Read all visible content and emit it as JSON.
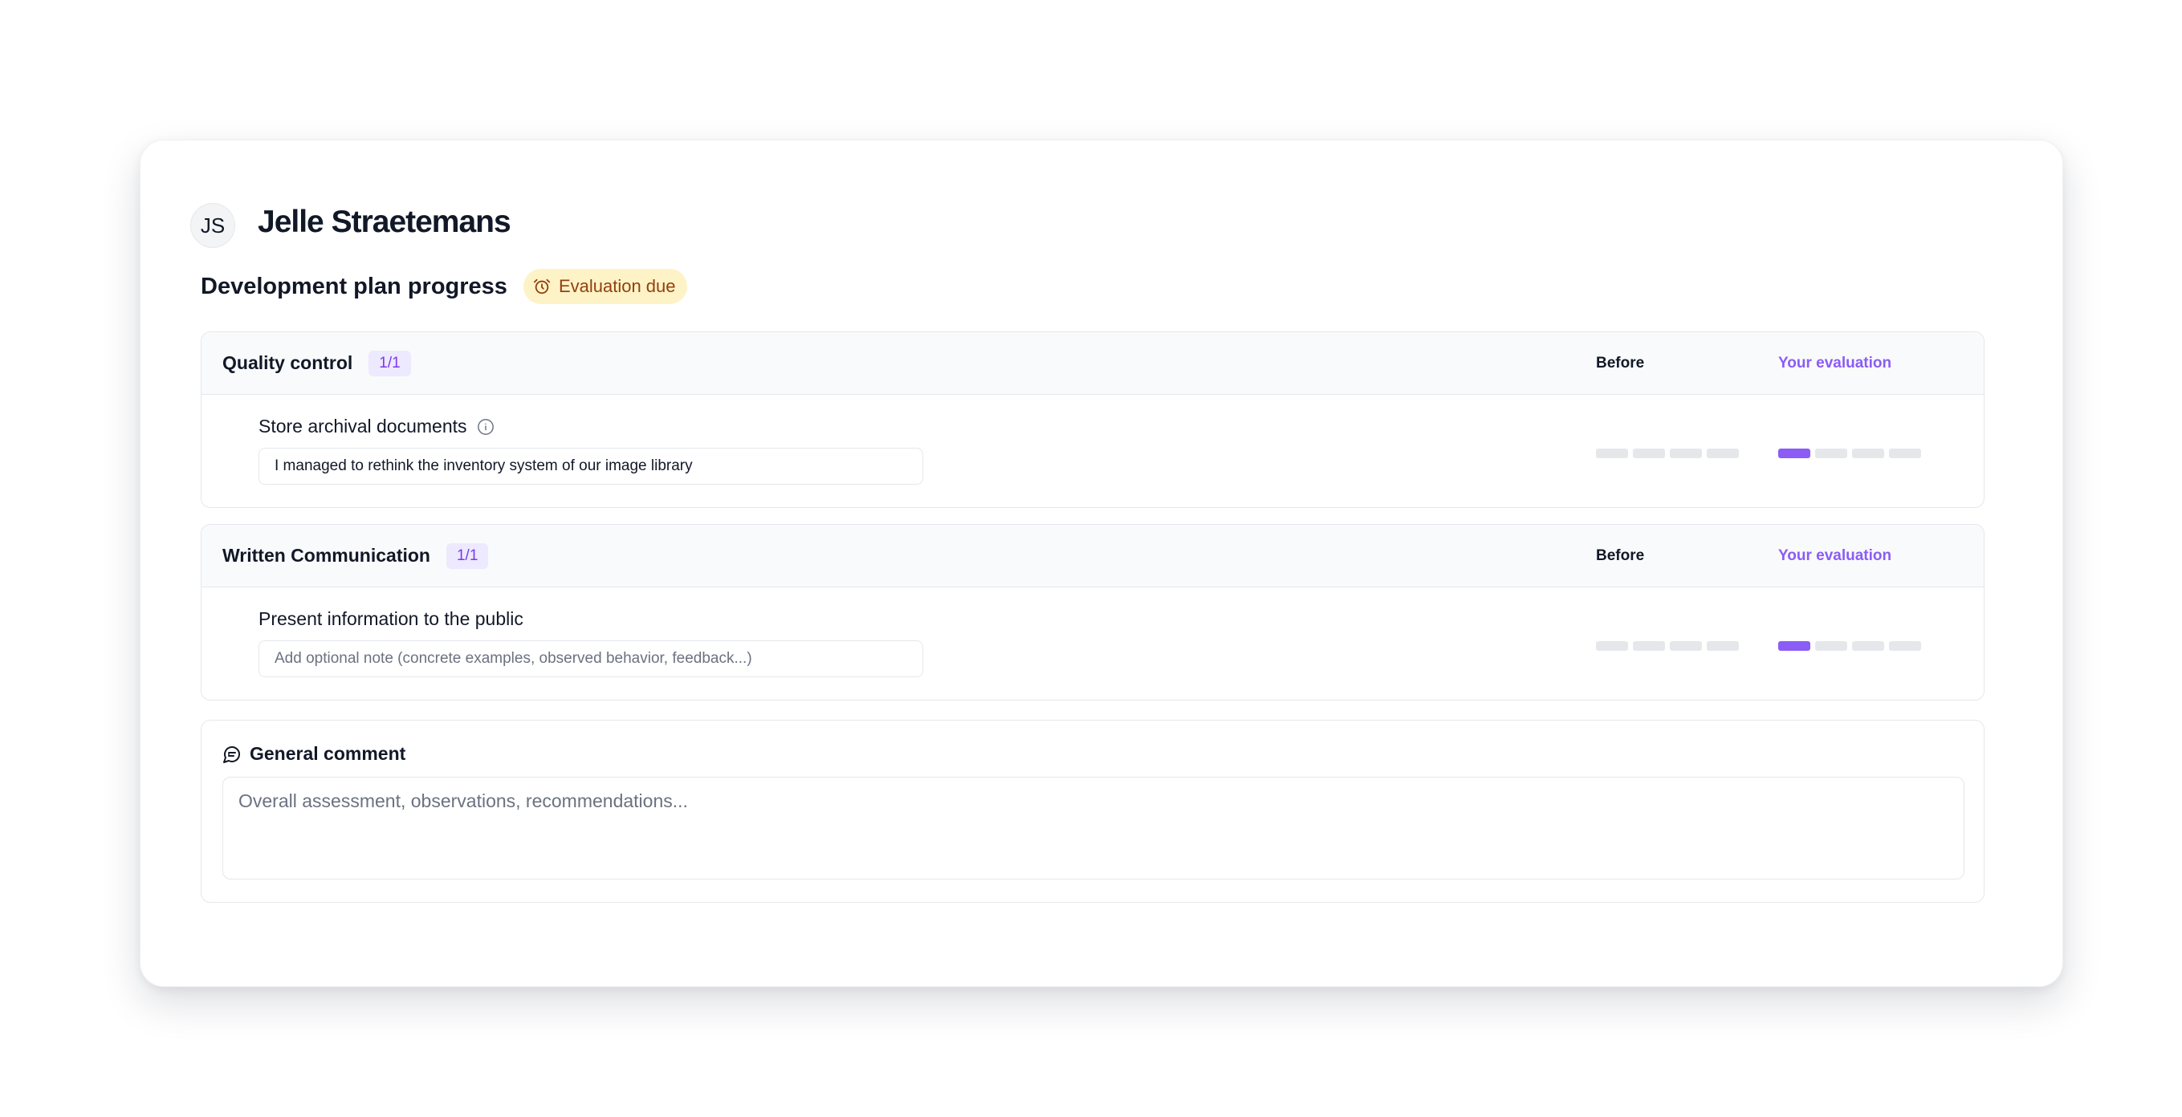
{
  "person": {
    "initials": "JS",
    "name": "Jelle Straetemans"
  },
  "plan": {
    "title": "Development plan progress",
    "status": "Evaluation due"
  },
  "columns": {
    "before": "Before",
    "evaluation": "Your evaluation"
  },
  "sections": [
    {
      "title": "Quality control",
      "count": "1/1",
      "skill": {
        "name": "Store archival documents",
        "has_info": true,
        "note_value": "I managed to rethink the inventory system of our image library",
        "note_placeholder": "Add optional note (concrete examples, observed behavior, feedback...)",
        "before_level": 0,
        "evaluation_level": 1,
        "scale_max": 4
      }
    },
    {
      "title": "Written Communication",
      "count": "1/1",
      "skill": {
        "name": "Present information to the public",
        "has_info": false,
        "note_value": "",
        "note_placeholder": "Add optional note (concrete examples, observed behavior, feedback...)",
        "before_level": 0,
        "evaluation_level": 1,
        "scale_max": 4
      }
    }
  ],
  "general_comment": {
    "label": "General comment",
    "placeholder": "Overall assessment, observations, recommendations..."
  },
  "colors": {
    "accent": "#8b5cf6",
    "badge_bg": "#fef3c7",
    "badge_text": "#92400e",
    "scale_empty": "#e5e7eb"
  },
  "icons": {
    "status": "alarm-clock-icon",
    "info": "info-icon",
    "comment": "message-circle-icon"
  }
}
